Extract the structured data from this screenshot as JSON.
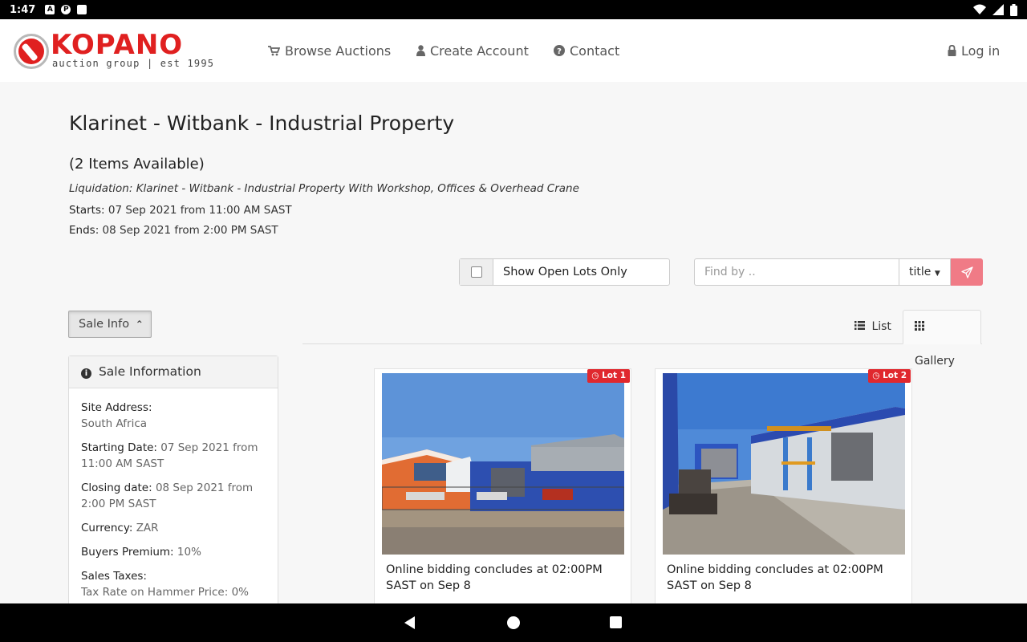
{
  "status_bar": {
    "time": "1:47",
    "icons": [
      "a-icon",
      "notification-icon",
      "sd-card-icon"
    ],
    "right_icons": [
      "wifi-icon",
      "signal-icon",
      "battery-icon"
    ]
  },
  "header": {
    "logo": {
      "word": "KOPANO",
      "tagline": "auction group | est 1995"
    },
    "nav": {
      "browse": "Browse Auctions",
      "create": "Create Account",
      "contact": "Contact",
      "login": "Log in"
    }
  },
  "auction": {
    "title": "Klarinet - Witbank - Industrial Property",
    "items_available": "(2 Items Available)",
    "description": "Liquidation: Klarinet - Witbank - Industrial Property With Workshop, Offices & Overhead Crane",
    "starts_label": "Starts:",
    "starts_value": "07 Sep 2021 from 11:00 AM SAST",
    "ends_label": "Ends:",
    "ends_value": "08 Sep 2021 from 2:00 PM SAST"
  },
  "filters": {
    "open_lots_label": "Show Open Lots Only",
    "open_lots_checked": false,
    "search_placeholder": "Find by ..",
    "search_field": "title"
  },
  "sale_info_toggle": "Sale Info",
  "view_tabs": {
    "list": "List",
    "gallery": "Gallery",
    "active": "gallery"
  },
  "sale_information": {
    "heading": "Sale Information",
    "rows": [
      {
        "key": "Site Address:",
        "value": "South Africa"
      },
      {
        "key": "Starting Date:",
        "value": "07 Sep 2021 from 11:00 AM SAST"
      },
      {
        "key": "Closing date:",
        "value": "08 Sep 2021 from 2:00 PM SAST"
      },
      {
        "key": "Currency:",
        "value": "ZAR"
      },
      {
        "key": "Buyers Premium:",
        "value": "10%"
      },
      {
        "key": "Sales Taxes:",
        "value": "Tax Rate on Hammer Price: 0%"
      }
    ]
  },
  "lots": [
    {
      "badge": "Lot 1",
      "caption": "Online bidding concludes at 02:00PM SAST on Sep 8"
    },
    {
      "badge": "Lot 2",
      "caption": "Online bidding concludes at 02:00PM SAST on Sep 8"
    }
  ],
  "colors": {
    "brand_red": "#e02020",
    "badge_red": "#e0282e",
    "search_button": "#f07b86"
  }
}
